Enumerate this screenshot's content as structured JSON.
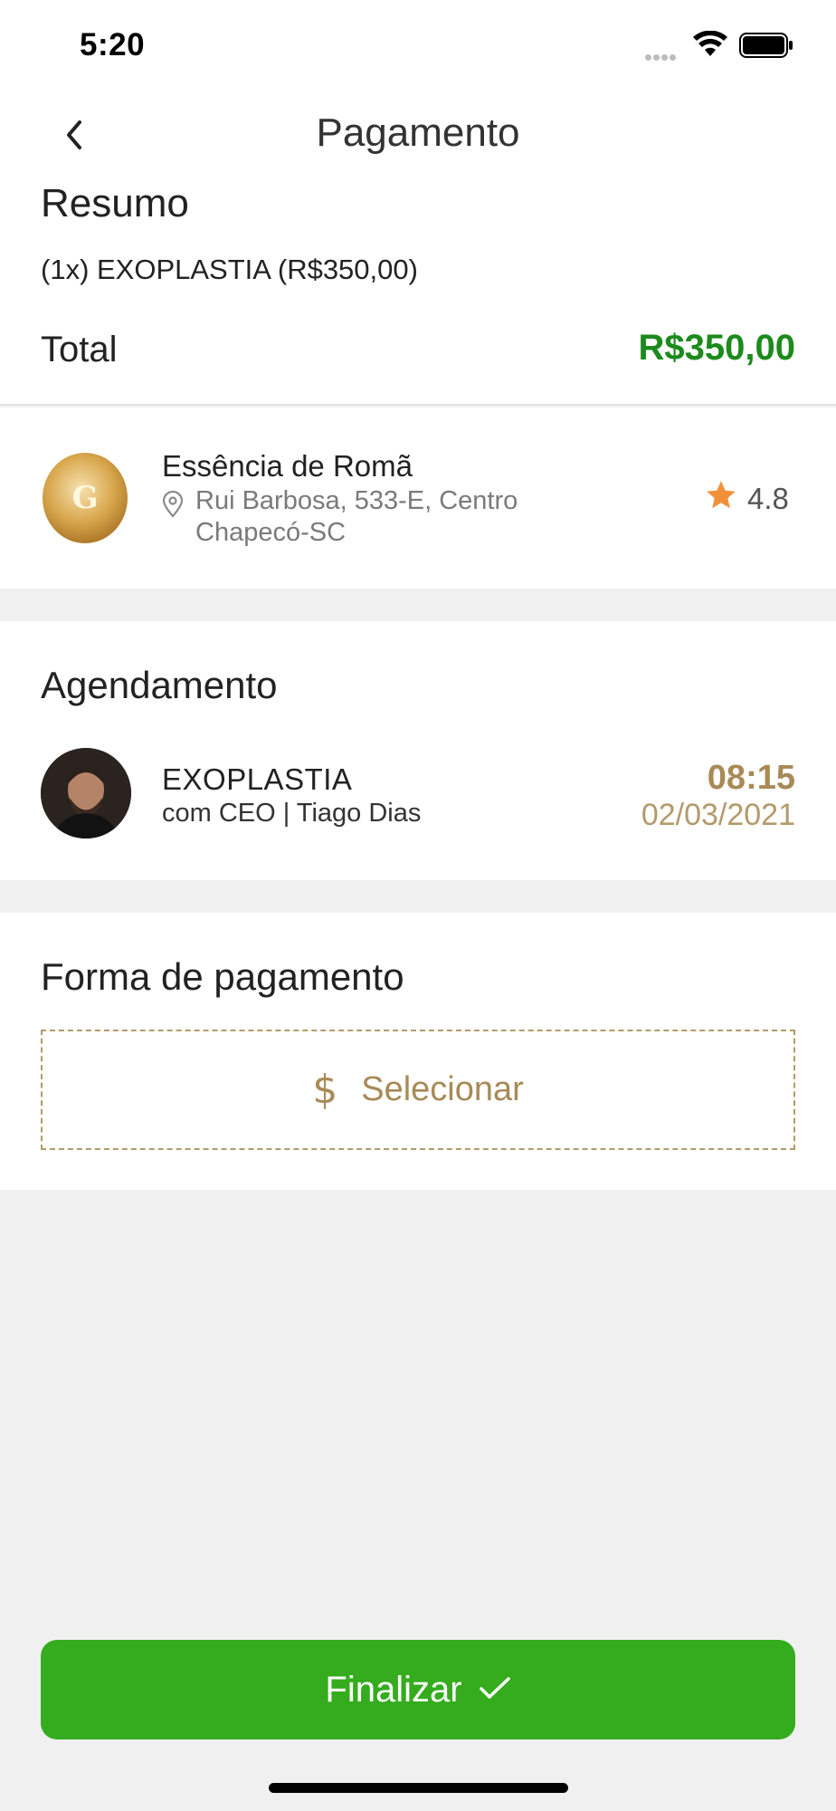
{
  "status_bar": {
    "time": "5:20",
    "icons": [
      "signal-icon",
      "wifi-icon",
      "battery-icon"
    ]
  },
  "nav": {
    "title": "Pagamento",
    "back_icon": "chevron-left-icon"
  },
  "summary": {
    "title": "Resumo",
    "item": "(1x) EXOPLASTIA (R$350,00)",
    "total_label": "Total",
    "total_value": "R$350,00"
  },
  "salon": {
    "name": "Essência de Romã",
    "address_line1": "Rui Barbosa, 533-E, Centro",
    "address_line2": "Chapecó-SC",
    "rating": "4.8",
    "logo_letter": "G"
  },
  "schedule": {
    "title": "Agendamento",
    "service": "EXOPLASTIA",
    "professional": "com CEO | Tiago Dias",
    "time": "08:15",
    "date": "02/03/2021"
  },
  "payment": {
    "title": "Forma de pagamento",
    "select_label": "Selecionar",
    "icon_glyph": "$"
  },
  "actions": {
    "finish_label": "Finalizar"
  },
  "colors": {
    "accent_gold": "#a88a57",
    "total_green": "#1c8a1c",
    "button_green": "#35ac1e",
    "star_orange": "#f0913a"
  }
}
